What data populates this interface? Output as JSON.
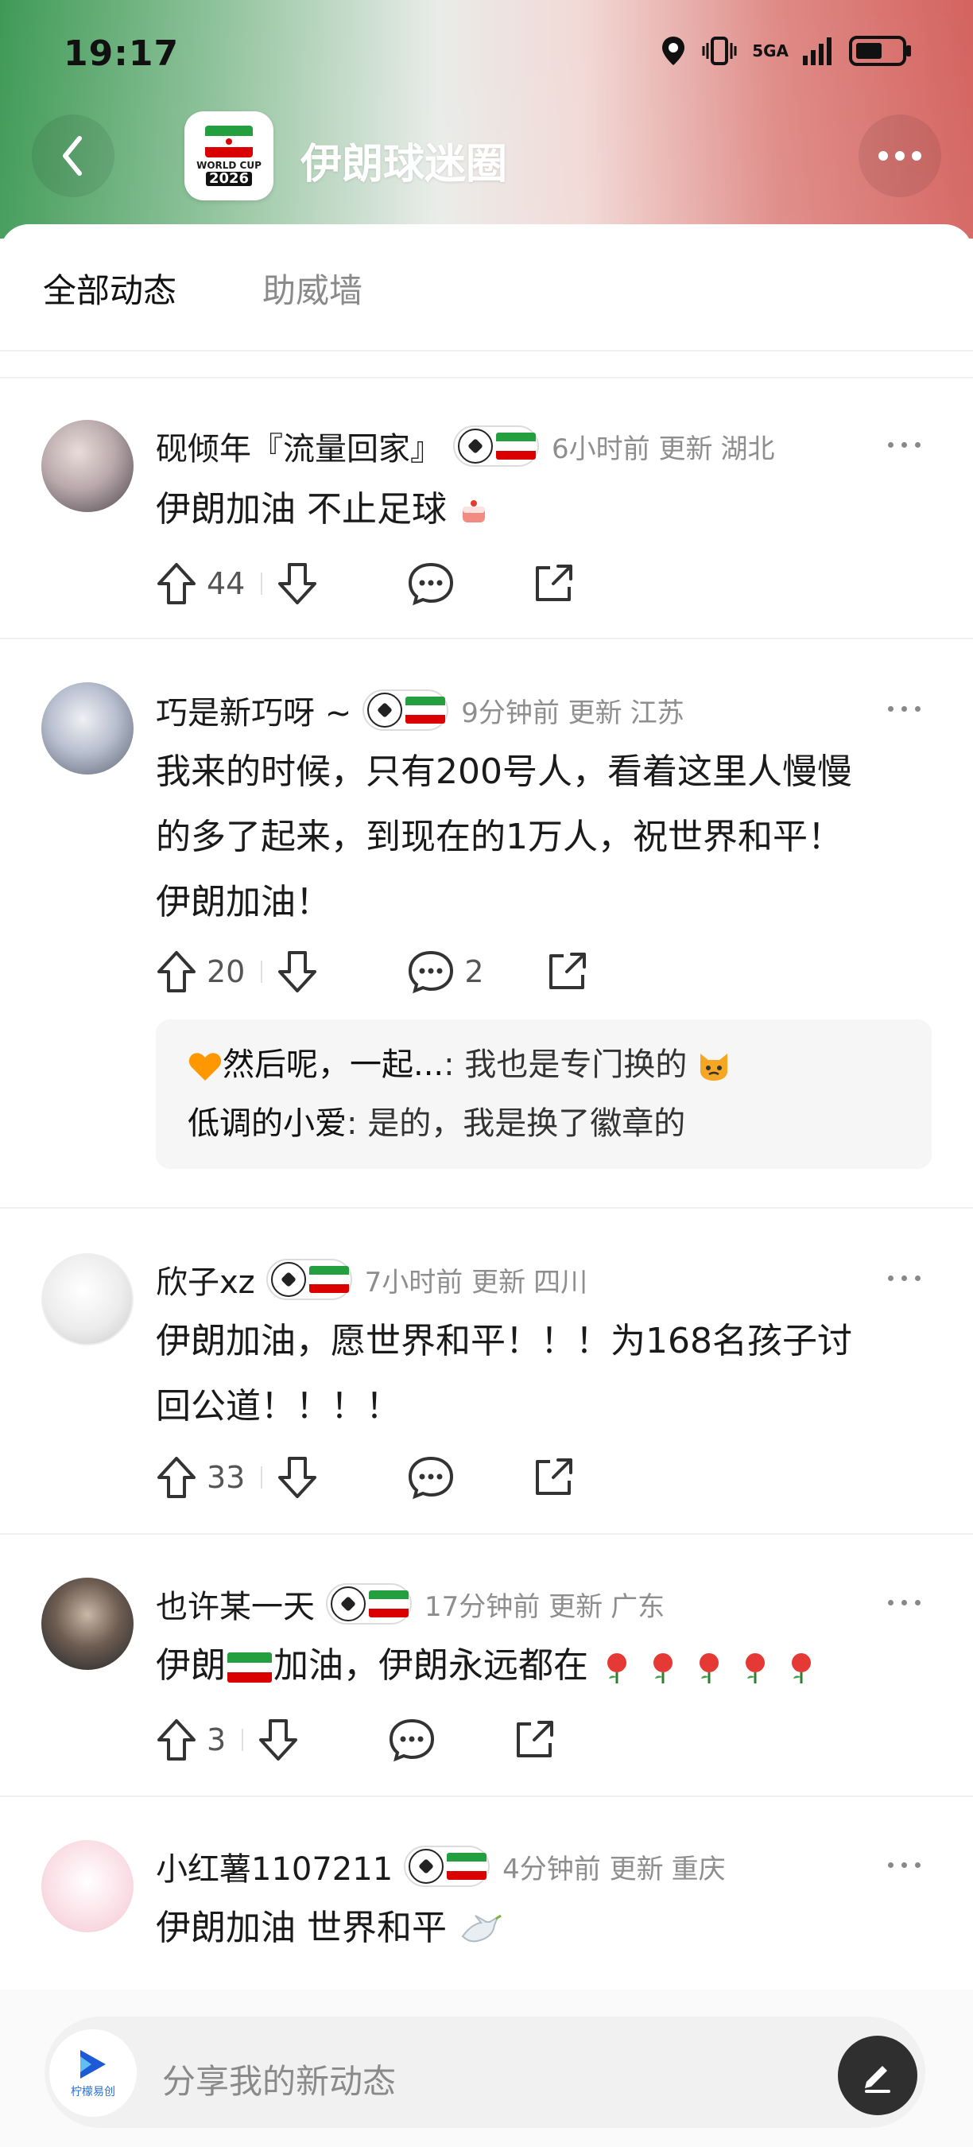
{
  "status_bar": {
    "time": "19:17",
    "network": "5GA"
  },
  "header": {
    "title": "伊朗球迷圈",
    "logo_text_line1": "WORLD CUP",
    "logo_text_line2": "2026"
  },
  "tabs": [
    {
      "label": "全部动态",
      "active": true
    },
    {
      "label": "助威墙",
      "active": false
    }
  ],
  "posts": [
    {
      "username": "砚倾年『流量回家』",
      "time": "6小时前 更新",
      "location": "湖北",
      "text": "伊朗加油 不止足球",
      "upvotes": "44",
      "comments": ""
    },
    {
      "username": "巧是新巧呀 ~",
      "time": "9分钟前 更新",
      "location": "江苏",
      "text_lines": [
        "我来的时候，只有200号人，看着这里人慢慢",
        "的多了起来，到现在的1万人，祝世界和平！",
        "伊朗加油！"
      ],
      "upvotes": "20",
      "comments": "2",
      "replies": [
        {
          "name": "然后呢，一起...",
          "text": ": 我也是专门换的"
        },
        {
          "name": "低调的小爱",
          "text": ": 是的，我是换了徽章的"
        }
      ]
    },
    {
      "username": "欣子xz",
      "time": "7小时前 更新",
      "location": "四川",
      "text_lines": [
        "伊朗加油，愿世界和平！！！为168名孩子讨",
        "回公道！！！！"
      ],
      "upvotes": "33",
      "comments": ""
    },
    {
      "username": "也许某一天",
      "time": "17分钟前 更新",
      "location": "广东",
      "text_before": "伊朗",
      "text_after": "加油，伊朗永远都在",
      "upvotes": "3",
      "comments": ""
    },
    {
      "username": "小红薯1107211",
      "time": "4分钟前 更新",
      "location": "重庆",
      "text": "伊朗加油 世界和平"
    }
  ],
  "composer": {
    "placeholder": "分享我的新动态",
    "logo_caption": "柠檬易创"
  },
  "colors": {
    "iran_green": "#239f40",
    "iran_red": "#da0000",
    "accent_dark": "#2f2f2f"
  }
}
